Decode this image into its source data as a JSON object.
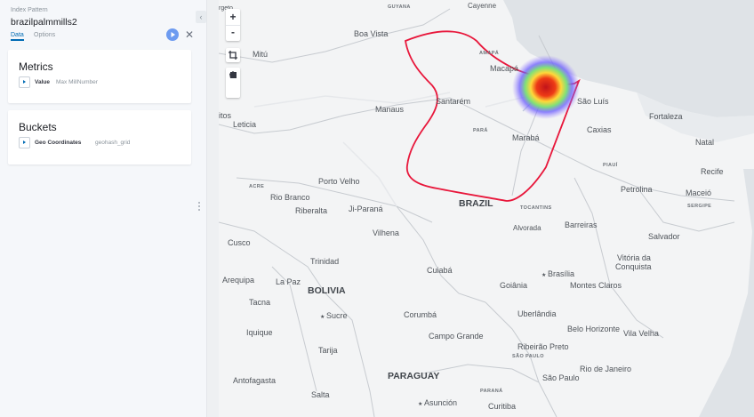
{
  "sidebar": {
    "index_pattern_label": "Index Pattern",
    "index_pattern_name": "brazilpalmmills2",
    "tabs": [
      {
        "label": "Data",
        "active": true
      },
      {
        "label": "Options",
        "active": false
      }
    ],
    "metrics": {
      "title": "Metrics",
      "agg_name": "Value",
      "agg_desc": "Max MillNumber"
    },
    "buckets": {
      "title": "Buckets",
      "agg_name": "Geo Coordinates",
      "agg_desc": "geohash_grid"
    },
    "accent_color": "#006bb4"
  },
  "map_controls": {
    "zoom_in": "+",
    "zoom_out": "-",
    "icons": [
      "crop-icon",
      "polygon-draw-icon",
      "rectangle-draw-icon"
    ]
  },
  "map": {
    "labels": {
      "guyana": "GUYANA",
      "cayenne": "Cayenne",
      "georgetown": "rgeto",
      "boa_vista": "Boa Vista",
      "mitu": "Mitú",
      "macapa": "Macapá",
      "amapa": "AMAPÁ",
      "santarem": "Santarém",
      "manaus": "Manaus",
      "leticia": "Leticia",
      "itos": "itos",
      "para": "PARÁ",
      "maraba": "Marabá",
      "sao_luis": "São Luís",
      "fortaleza": "Fortaleza",
      "caxias": "Caxias",
      "natal": "Natal",
      "piaui": "PIAUÍ",
      "recife": "Recife",
      "acre": "ACRE",
      "porto_velho": "Porto Velho",
      "rio_branco": "Rio Branco",
      "riberalta": "Riberalta",
      "ji_parana": "Ji-Paraná",
      "brazil": "BRAZIL",
      "tocantins": "TOCANTINS",
      "petrolina": "Petrolina",
      "maceio": "Maceió",
      "sergipe": "SERGIPE",
      "alvorada": "Alvorada",
      "barreiras": "Barreiras",
      "salvador": "Salvador",
      "vilhena": "Vilhena",
      "cusco": "Cusco",
      "trinidad": "Trinidad",
      "vitoria": "Vitória da",
      "conquista": "Conquista",
      "cuiaba": "Cuiabá",
      "brasilia": "Brasília",
      "arequipa": "Arequipa",
      "la_paz": "La Paz",
      "bolivia": "BOLIVIA",
      "goiania": "Goiânia",
      "montes_claros": "Montes Claros",
      "tacna": "Tacna",
      "sucre": "Sucre",
      "corumba": "Corumbá",
      "uberlandia": "Uberlândia",
      "iquique": "Iquique",
      "campo_grande": "Campo Grande",
      "belo_horizonte": "Belo Horizonte",
      "vila_velha": "Vila Velha",
      "ribeirao_preto": "Ribeirão Preto",
      "sao_paulo_state": "SÃO PAULO",
      "tarija": "Tarija",
      "rio": "Rio de Janeiro",
      "antofagasta": "Antofagasta",
      "paraguay": "PARAGUAY",
      "sao_paulo": "São Paulo",
      "salta": "Salta",
      "parana": "PARANÁ",
      "asuncion": "Asunción",
      "curitiba": "Curitiba"
    },
    "colors": {
      "polygon": "#e8173b",
      "heat_core": "#d81b1b",
      "heat_mid": "#ffd83a",
      "heat_outer": "#6a5cff"
    }
  }
}
